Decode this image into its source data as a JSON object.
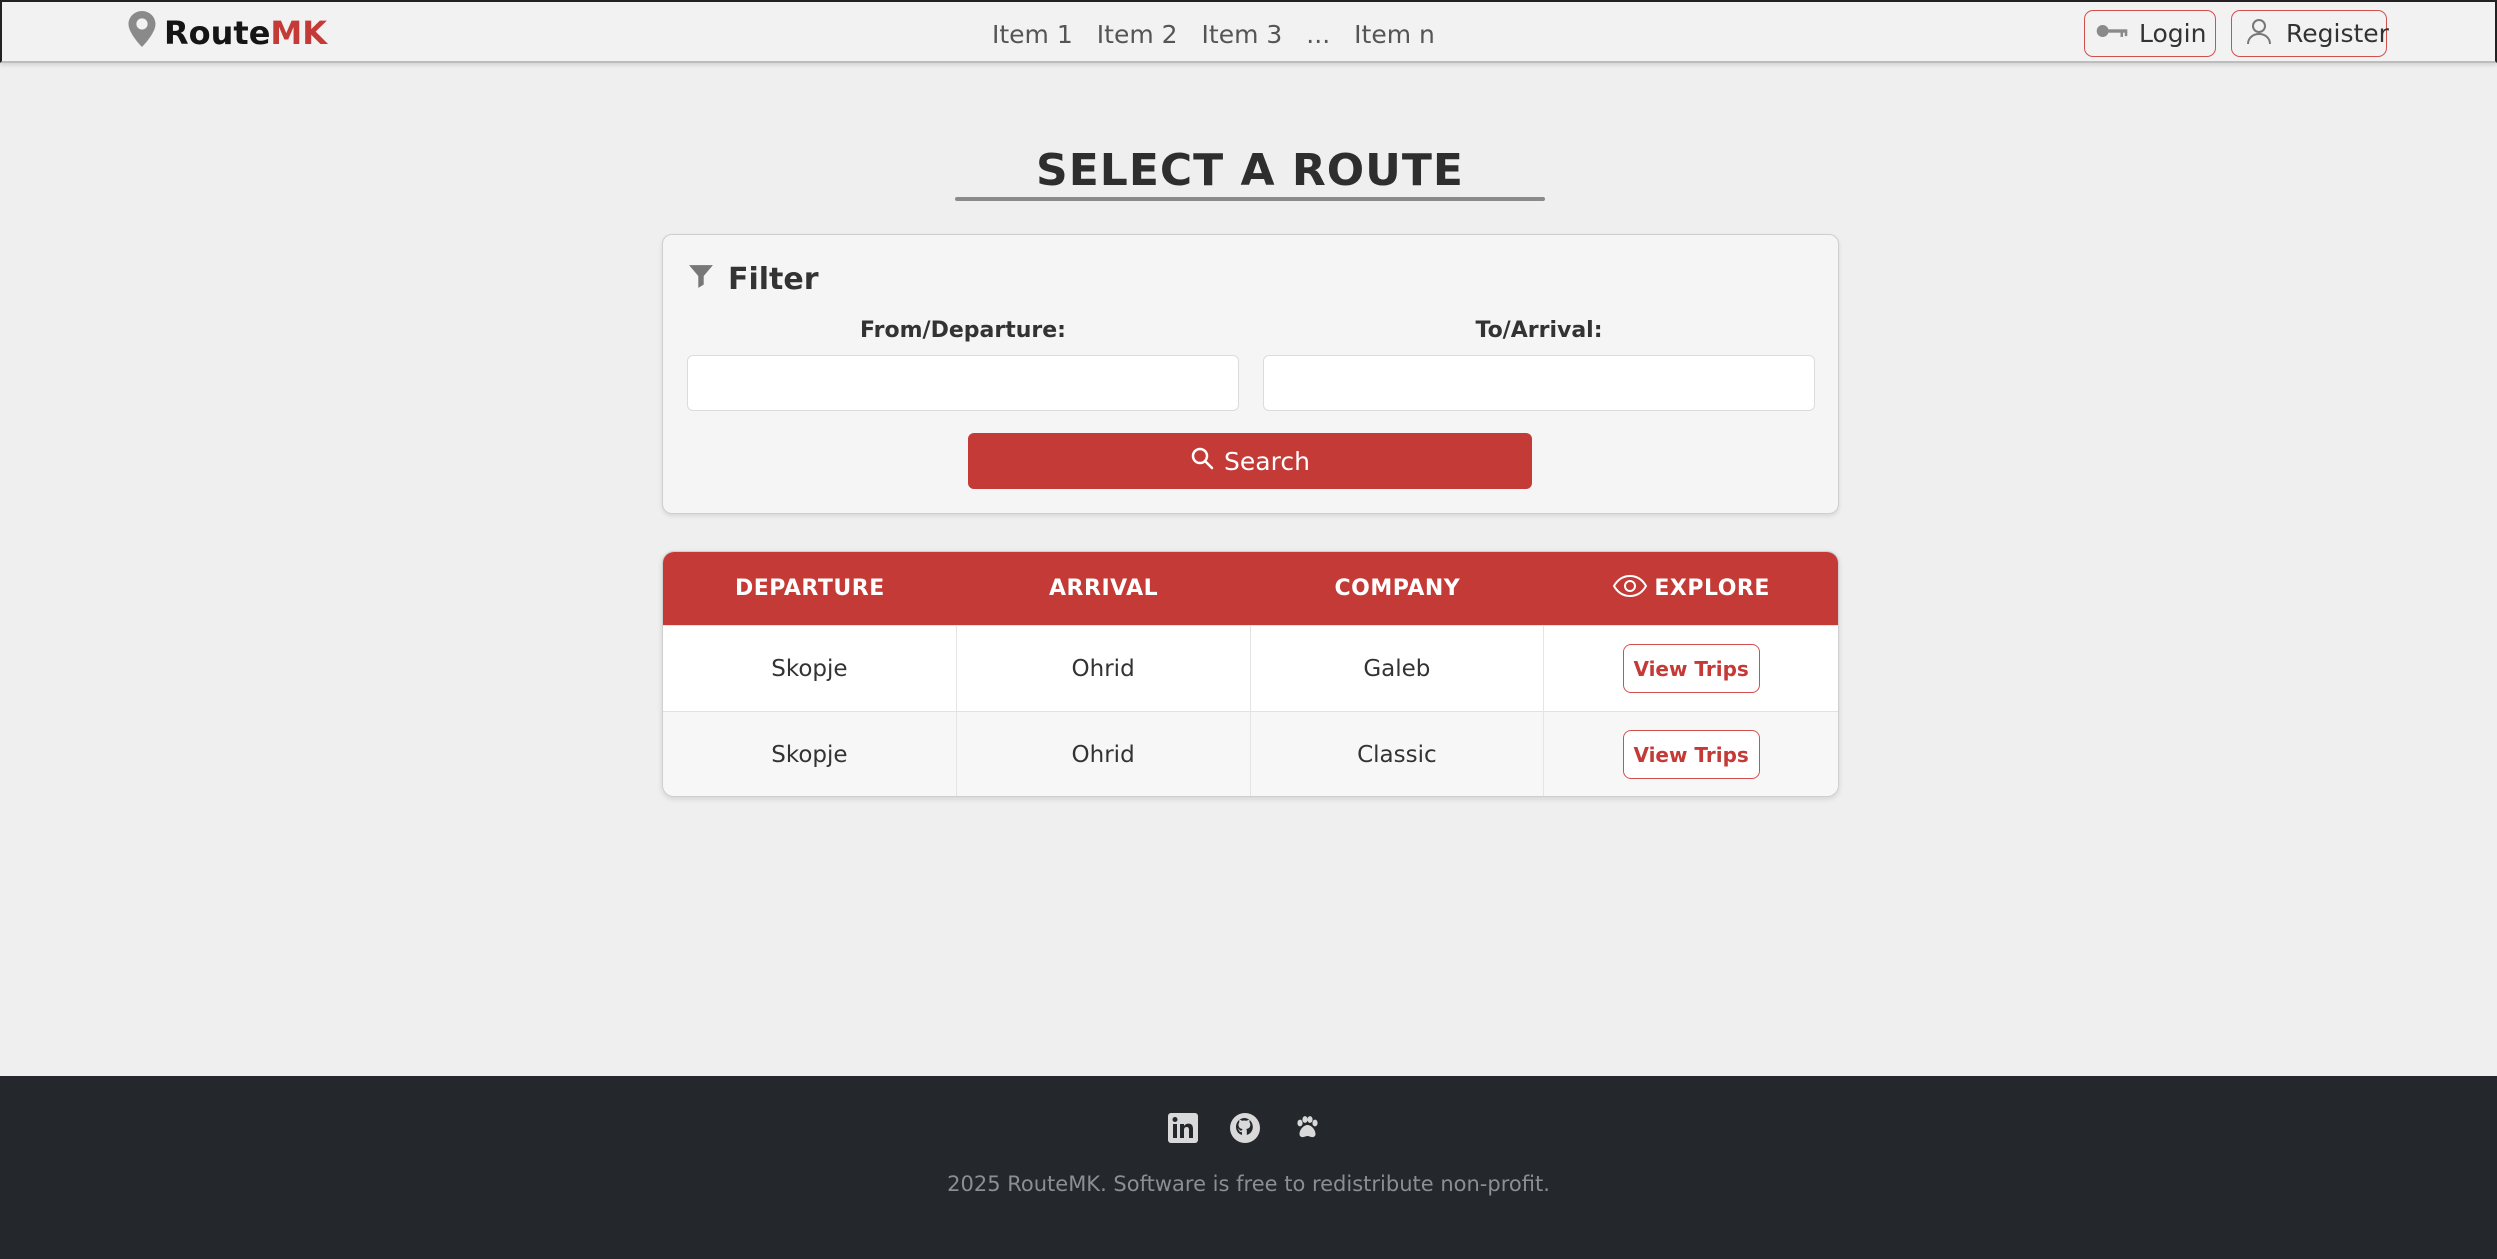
{
  "brand": {
    "name_prefix": "Route",
    "name_suffix": "MK",
    "icon": "map-pin-icon"
  },
  "nav": {
    "items": [
      "Item 1",
      "Item 2",
      "Item 3",
      "...",
      "Item n"
    ],
    "login_label": "Login",
    "register_label": "Register"
  },
  "page": {
    "title": "SELECT A ROUTE"
  },
  "filter": {
    "heading": "Filter",
    "from_label": "From/Departure:",
    "from_value": "",
    "to_label": "To/Arrival:",
    "to_value": "",
    "search_label": "Search"
  },
  "table": {
    "headers": [
      "DEPARTURE",
      "ARRIVAL",
      "COMPANY",
      "EXPLORE"
    ],
    "rows": [
      {
        "departure": "Skopje",
        "arrival": "Ohrid",
        "company": "Galeb",
        "action": "View Trips"
      },
      {
        "departure": "Skopje",
        "arrival": "Ohrid",
        "company": "Classic",
        "action": "View Trips"
      }
    ]
  },
  "footer": {
    "icons": [
      "linkedin-icon",
      "github-icon",
      "paw-icon"
    ],
    "copyright": "2025 RouteMK. Software is free to redistribute non-profit."
  },
  "colors": {
    "accent": "#c43a36",
    "footer_bg": "#24272b",
    "page_bg": "#efefef"
  }
}
